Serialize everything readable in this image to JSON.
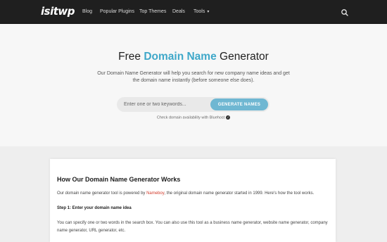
{
  "nav": {
    "logo": "isitwp",
    "items": [
      {
        "label": "Blog"
      },
      {
        "label": "Popular Plugins"
      },
      {
        "label": "Top Themes"
      },
      {
        "label": "Deals"
      },
      {
        "label": "Tools"
      }
    ],
    "search_icon": "search-icon",
    "tools_icon": "chevron-down-icon"
  },
  "hero": {
    "title_prefix": "Free ",
    "title_accent": "Domain Name",
    "title_suffix": " Generator",
    "description": "Our Domain Name Generator will help you search for new company name ideas and get the domain name instantly (before someone else does).",
    "search_placeholder": "Enter one or two keywords...",
    "button_label": "GENERATE NAMES",
    "check_note": "Check domain availability with Bluehost",
    "check_icon": "checkmark-badge-icon"
  },
  "article": {
    "title": "How Our Domain Name Generator Works",
    "p1_before": "Our domain name generator tool is powered by ",
    "p1_link": "Nameboy",
    "p1_after": ", the original domain name generator started in 1999. Here's how the tool works.",
    "step1": "Step 1: Enter your domain name idea",
    "p2": "You can specify one or two words in the search box. You can also use this tool as a business name generator, website name generator, company name generator, URL generator, etc."
  },
  "colors": {
    "accent": "#3fa8c9",
    "button": "#6fb7d2",
    "link": "#d23c2c",
    "nav_bg": "#1f1f1f"
  }
}
